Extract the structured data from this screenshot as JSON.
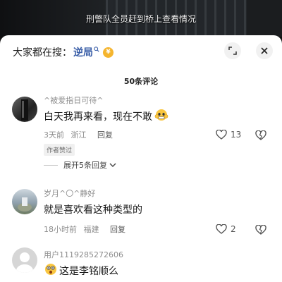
{
  "video": {
    "subtitle": "刑警队全员赶到桥上查看情况"
  },
  "header": {
    "search_prefix": "大家都在搜：",
    "search_term": "逆局",
    "coin_label": "¥"
  },
  "comment_count": "50条评论",
  "comments": [
    {
      "name": "^被爱指日可待^",
      "text": "白天我再来看，现在不敢",
      "time": "3天前",
      "location": "浙江",
      "reply_label": "回复",
      "likes": "13",
      "badge": "作者赞过",
      "expand_label": "展开5条回复"
    },
    {
      "name": "岁月^〇^静好",
      "text": "就是喜欢看这种类型的",
      "time": "18小时前",
      "location": "福建",
      "reply_label": "回复",
      "likes": "2"
    },
    {
      "name": "用户1119285272606",
      "text": "这是李铭顺么"
    }
  ],
  "colors": {
    "link": "#3b5fa8",
    "coin": "#f5b52e"
  }
}
